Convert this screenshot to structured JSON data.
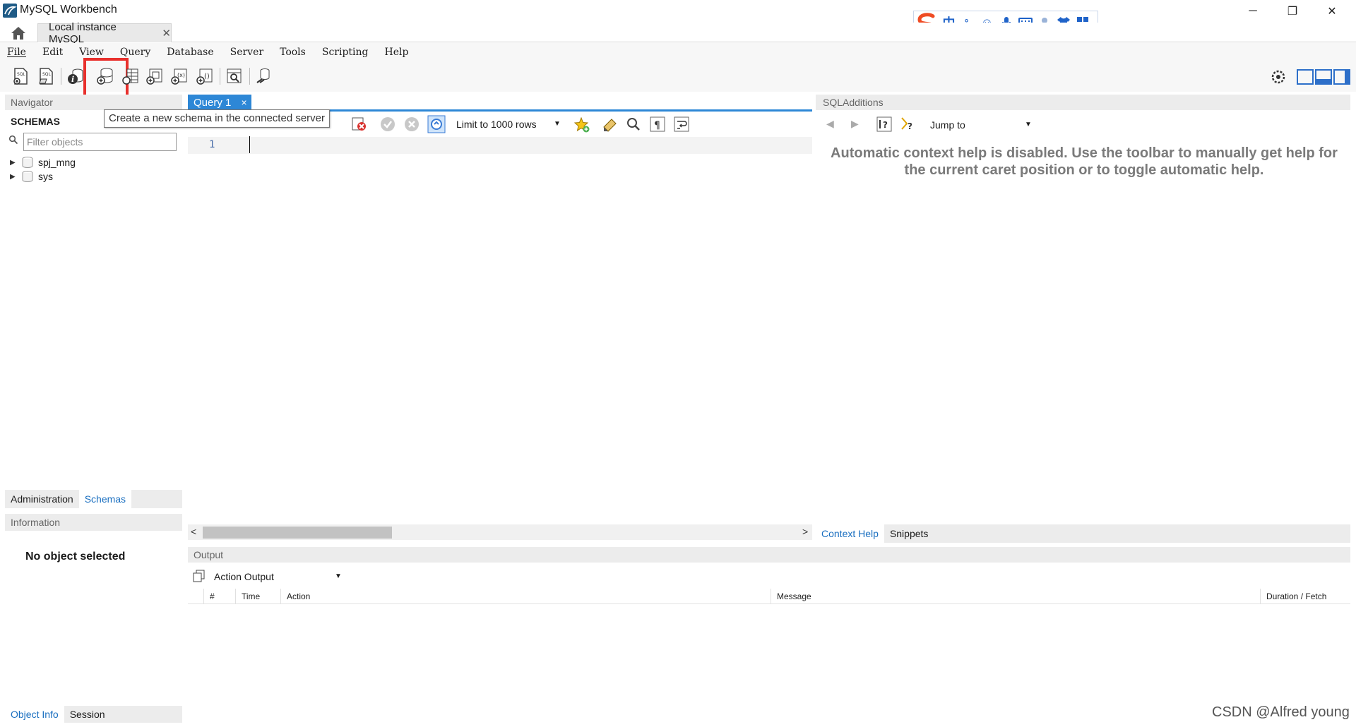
{
  "window": {
    "title": "MySQL Workbench",
    "minimize": "─",
    "maximize": "❐",
    "close": "✕"
  },
  "tabs": {
    "instance_label": "Local instance MySQL",
    "instance_close": "✕"
  },
  "menu": [
    "File",
    "Edit",
    "View",
    "Query",
    "Database",
    "Server",
    "Tools",
    "Scripting",
    "Help"
  ],
  "toolbar": {
    "highlighted": "create-schema-icon",
    "tooltip": "Create a new schema in the connected server"
  },
  "navigator": {
    "header": "Navigator",
    "schemas_title": "SCHEMAS",
    "filter_placeholder": "Filter objects",
    "schemas": [
      "spj_mng",
      "sys"
    ],
    "tabs": [
      "Administration",
      "Schemas"
    ],
    "active_tab": "Schemas"
  },
  "information": {
    "header": "Information",
    "message": "No object selected",
    "tabs": [
      "Object Info",
      "Session"
    ]
  },
  "query": {
    "tab_label": "Query 1",
    "tab_close": "×",
    "limit_rows": "Limit to 1000 rows",
    "line_number": "1"
  },
  "sql_additions": {
    "header": "SQLAdditions",
    "jump_to": "Jump to",
    "context_help": "Automatic context help is disabled. Use the toolbar to manually get help for the current caret position or to toggle automatic help.",
    "tabs": [
      "Context Help",
      "Snippets"
    ]
  },
  "output": {
    "header": "Output",
    "selector": "Action Output",
    "columns": [
      "#",
      "Time",
      "Action",
      "Message",
      "Duration / Fetch"
    ]
  },
  "ime": {
    "chinese_char": "中",
    "punct": "°,"
  },
  "watermark": "CSDN @Alfred young",
  "colors": {
    "accent": "#2d87d6",
    "highlight_box": "#e8302c",
    "link": "#1a6fc0"
  }
}
